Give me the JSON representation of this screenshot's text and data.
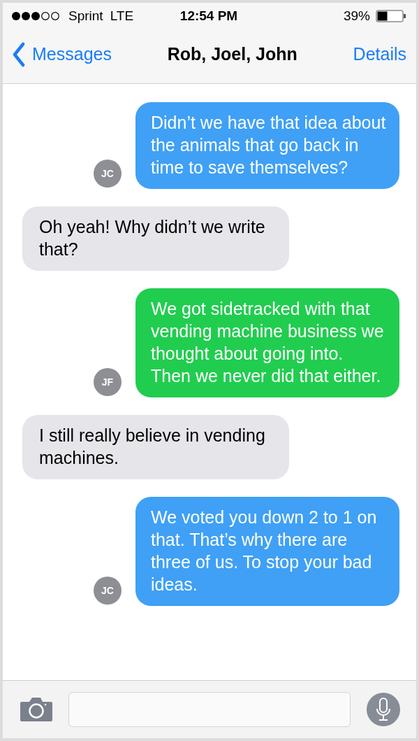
{
  "status_bar": {
    "carrier": "Sprint",
    "network": "LTE",
    "time": "12:54 PM",
    "battery": "39%"
  },
  "nav": {
    "back": "Messages",
    "title": "Rob, Joel, John",
    "action": "Details"
  },
  "messages": [
    {
      "kind": "outgoing",
      "text": "Didn’t we have that idea about the animals that go back in time to save themselves?",
      "avatar": "JC",
      "color": "#3fa0f5"
    },
    {
      "kind": "incoming",
      "text": "Oh yeah! Why didn’t we write that?"
    },
    {
      "kind": "outgoing",
      "text": "We got sidetracked with that vending machine business we thought about going into. Then we never did that either.",
      "avatar": "JF",
      "color": "#21cd4f"
    },
    {
      "kind": "incoming",
      "text": "I still really believe in vending machines."
    },
    {
      "kind": "outgoing",
      "text": "We voted you down 2 to 1 on that. That’s why there are three of us. To stop your bad ideas.",
      "avatar": "JC",
      "color": "#3fa0f5"
    }
  ]
}
